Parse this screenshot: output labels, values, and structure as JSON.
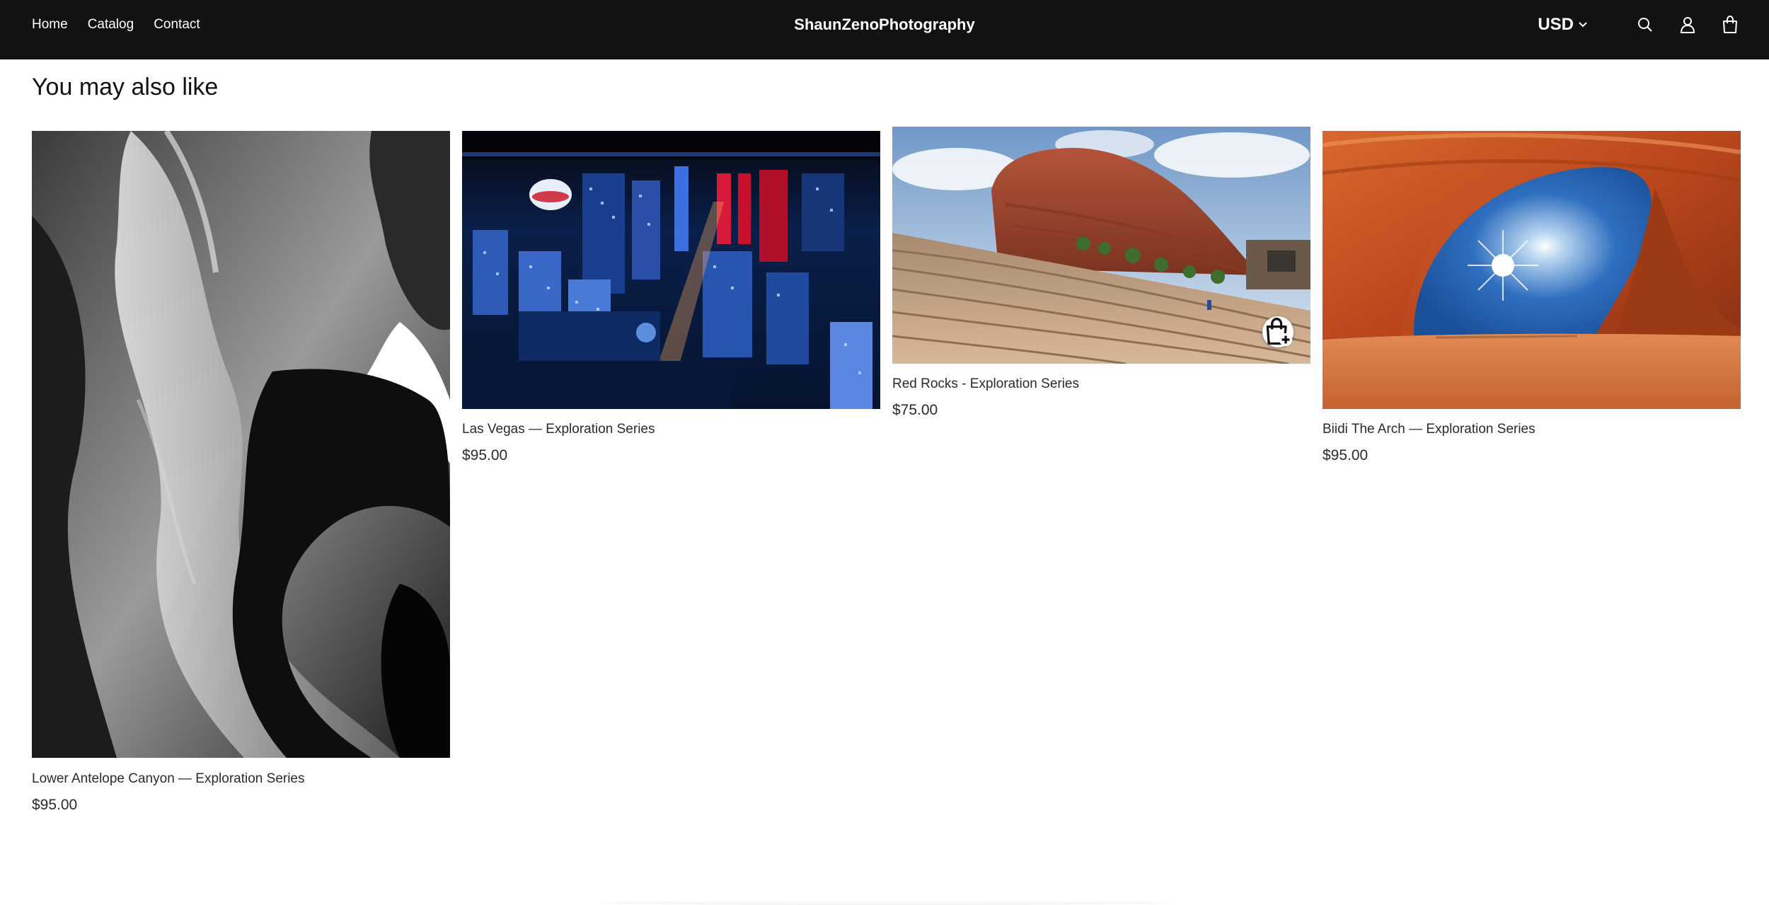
{
  "header": {
    "nav": [
      "Home",
      "Catalog",
      "Contact"
    ],
    "brand": "ShaunZenoPhotography",
    "currency": "USD",
    "icons": [
      "search-icon",
      "account-icon",
      "cart-icon"
    ]
  },
  "section": {
    "title": "You may also like"
  },
  "products": [
    {
      "title": "Lower Antelope Canyon — Exploration Series",
      "price": "$95.00",
      "image": "black-and-white slot canyon"
    },
    {
      "title": "Las Vegas — Exploration Series",
      "price": "$95.00",
      "image": "night city aerial"
    },
    {
      "title": "Red Rocks - Exploration Series",
      "price": "$75.00",
      "image": "red rock amphitheatre"
    },
    {
      "title": "Biidi The Arch — Exploration Series",
      "price": "$95.00",
      "image": "desert arch with sun"
    }
  ],
  "colors": {
    "header_bg": "#121212",
    "page_bg": "#ffffff",
    "text": "#121212"
  }
}
